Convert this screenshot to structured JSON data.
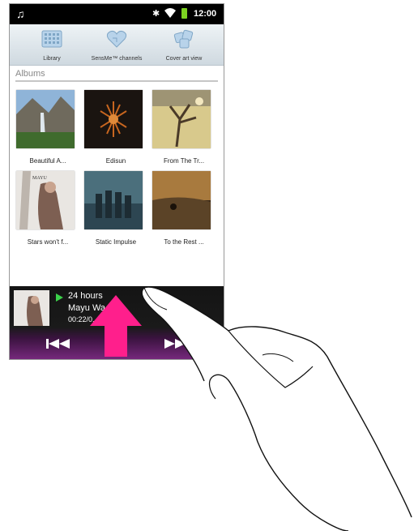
{
  "status_bar": {
    "time": "12:00",
    "music_icon": "music-note-icon",
    "bluetooth_icon": "bluetooth-icon",
    "wifi_icon": "wifi-icon",
    "battery_icon": "battery-icon"
  },
  "tabs": [
    {
      "label": "Library",
      "icon": "library-grid-icon"
    },
    {
      "label": "SensMe™ channels",
      "icon": "heart-channels-icon"
    },
    {
      "label": "Cover art view",
      "icon": "cover-art-icon"
    }
  ],
  "section_title": "Albums",
  "albums": [
    {
      "title": "Beautiful A..."
    },
    {
      "title": "Edisun"
    },
    {
      "title": "From The Tr..."
    },
    {
      "title": "Stars won't f..."
    },
    {
      "title": "Static Impulse"
    },
    {
      "title": "To the Rest ..."
    }
  ],
  "now_playing": {
    "title": "24 hours",
    "artist": "Mayu Wa...ka",
    "time": "00:22/0..."
  },
  "colors": {
    "status_bar": "#000000",
    "player_bottom": "#7a2a80",
    "play_indicator": "#3bd14a",
    "arrow": "#ff1f8c"
  }
}
